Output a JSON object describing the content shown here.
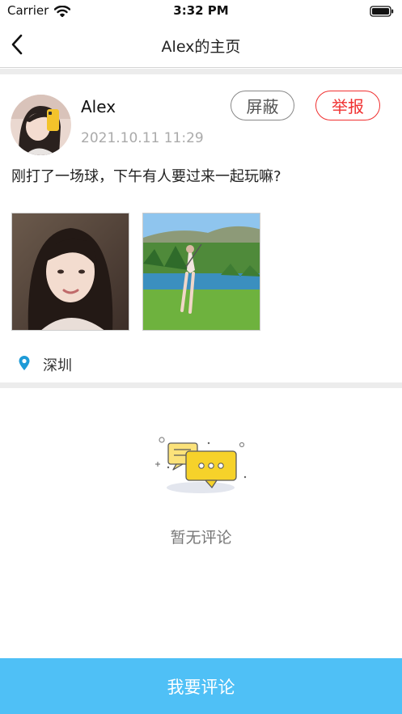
{
  "status_bar": {
    "carrier": "Carrier",
    "time": "3:32 PM"
  },
  "nav": {
    "back_icon": "chevron-left-icon",
    "title": "Alex的主页"
  },
  "post": {
    "author": "Alex",
    "timestamp": "2021.10.11 11:29",
    "block_label": "屏蔽",
    "report_label": "举报",
    "content": "刚打了一场球，下午有人要过来一起玩嘛?",
    "photos": [
      "portrait-photo",
      "golf-course-photo"
    ],
    "location": "深圳",
    "location_icon": "location-pin-icon"
  },
  "comments": {
    "empty_text": "暂无评论",
    "empty_icon": "chat-bubbles-icon"
  },
  "comment_button": {
    "label": "我要评论"
  },
  "colors": {
    "accent": "#4fc0f6",
    "report": "#f03030",
    "location_icon": "#1e9bd7",
    "illustration_yellow": "#f6d22a"
  }
}
